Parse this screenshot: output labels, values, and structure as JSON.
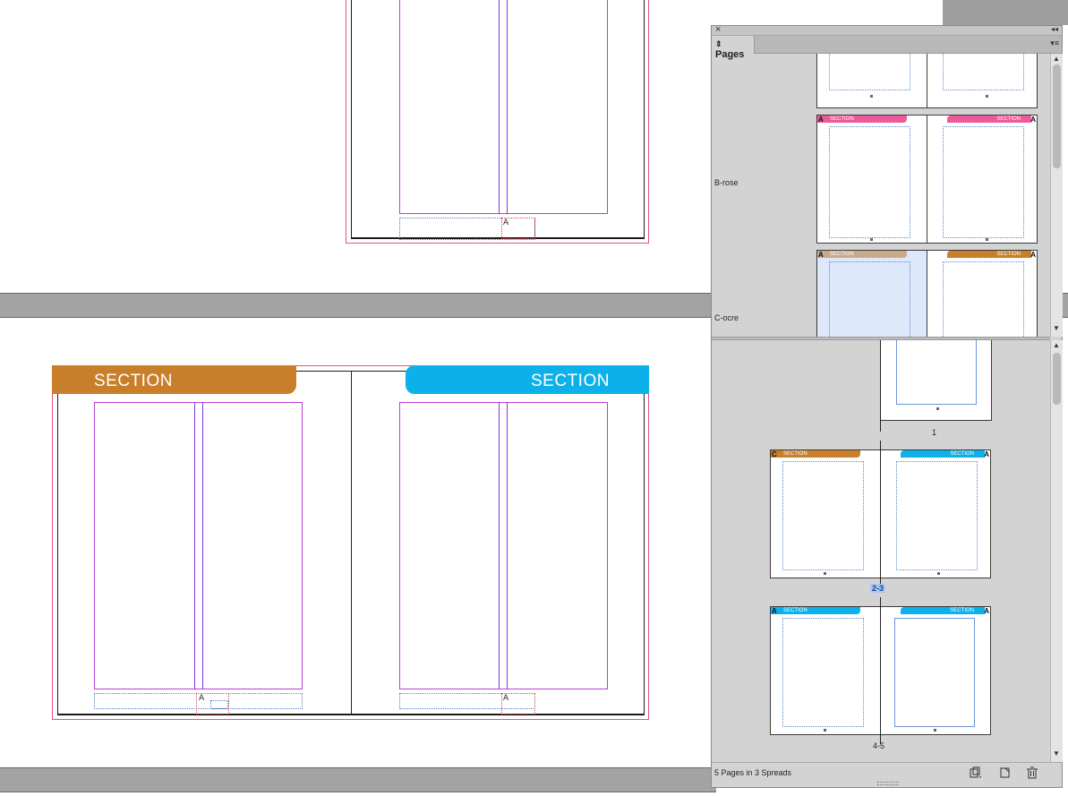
{
  "document": {
    "spread_top": {
      "footer_marker": "A"
    },
    "spread_bottom": {
      "left_tab_label": "SECTION",
      "right_tab_label": "SECTION",
      "footer_marker_left": "A",
      "footer_marker_right": "A"
    },
    "colors": {
      "ocre": "#c97f2a",
      "cyan": "#0db1ea",
      "rose": "#ef5a9a",
      "bleed": "#e0557a",
      "margin": "#b63fd6"
    }
  },
  "panel": {
    "close_glyph": "×",
    "collapse_glyph": "◂◂",
    "tab_label": "Pages",
    "tab_arrow": "⇕",
    "menu_glyph": "▾≡",
    "masters": [
      {
        "label": "",
        "left_prefix": "",
        "right_prefix": ""
      },
      {
        "label": "B-rose",
        "left_prefix": "A",
        "right_prefix": "A",
        "left_tab": "SECTION",
        "right_tab": "SECTION"
      },
      {
        "label": "C-ocre",
        "left_prefix": "A",
        "right_prefix": "A",
        "left_tab": "SECTION",
        "right_tab": "SECTION"
      }
    ],
    "pages": [
      {
        "label": "1"
      },
      {
        "label": "2-3",
        "left_prefix": "C",
        "right_prefix": "A",
        "left_tab": "SECTION",
        "right_tab": "SECTION",
        "selected": true
      },
      {
        "label": "4-5",
        "left_prefix": "A",
        "right_prefix": "A",
        "left_tab": "SECTION",
        "right_tab": "SECTION"
      }
    ],
    "status": "5 Pages in 3 Spreads",
    "icons": [
      "page-size-icon",
      "new-page-icon",
      "trash-icon"
    ]
  }
}
